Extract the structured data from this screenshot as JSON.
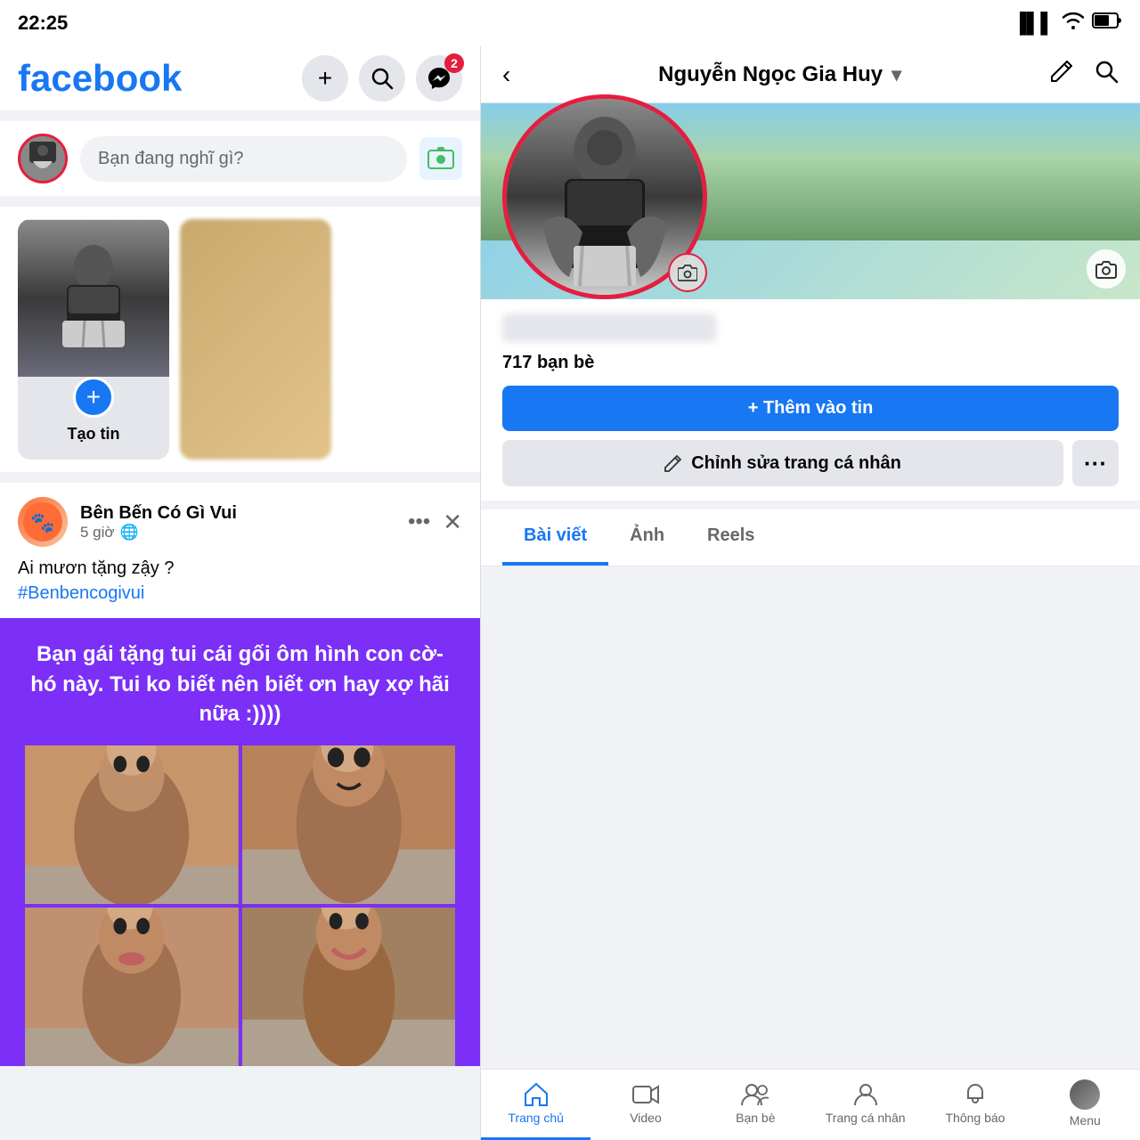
{
  "statusBar": {
    "time": "22:25",
    "signal": "▪▪▪",
    "wifi": "WiFi",
    "battery": "5+"
  },
  "left": {
    "logo": "facebook",
    "addLabel": "+",
    "searchLabel": "🔍",
    "messagesLabel": "💬",
    "messageBadge": "2",
    "postPlaceholder": "Bạn đang nghĩ gì?",
    "story": {
      "createLabel": "Tạo tin"
    },
    "post": {
      "pageName": "Bên Bến Có Gì Vui",
      "timeAgo": "5 giờ",
      "globe": "🌐",
      "text": "Ai mươn tặng zậy ?",
      "hashtag": "#Benbencogivui",
      "memeTitle": "Bạn gái tặng tui cái gối ôm hình con cờ-hó này. Tui ko biết nên biết ơn hay xợ hãi nữa :))))"
    }
  },
  "right": {
    "nav": {
      "back": "‹",
      "title": "Nguyễn Ngọc Gia Huy",
      "dropdown": "▾",
      "edit": "✏",
      "search": "🔍"
    },
    "profile": {
      "friendsCount": "717",
      "friendsLabel": "bạn bè",
      "addFriendBtn": "+ Thêm vào tin",
      "editProfileBtn": "✏ Chỉnh sửa trang cá nhân",
      "moreBtn": "···"
    },
    "tabs": {
      "baiViet": "Bài viết",
      "anh": "Ảnh",
      "reels": "Reels"
    },
    "bottomNav": [
      {
        "label": "Trang chủ",
        "icon": "⌂",
        "active": true
      },
      {
        "label": "Video",
        "icon": "▶"
      },
      {
        "label": "Bạn bè",
        "icon": "👥"
      },
      {
        "label": "Trang cá nhân",
        "icon": "👤"
      },
      {
        "label": "Thông báo",
        "icon": "🔔"
      },
      {
        "label": "Menu",
        "icon": "≡"
      }
    ]
  }
}
